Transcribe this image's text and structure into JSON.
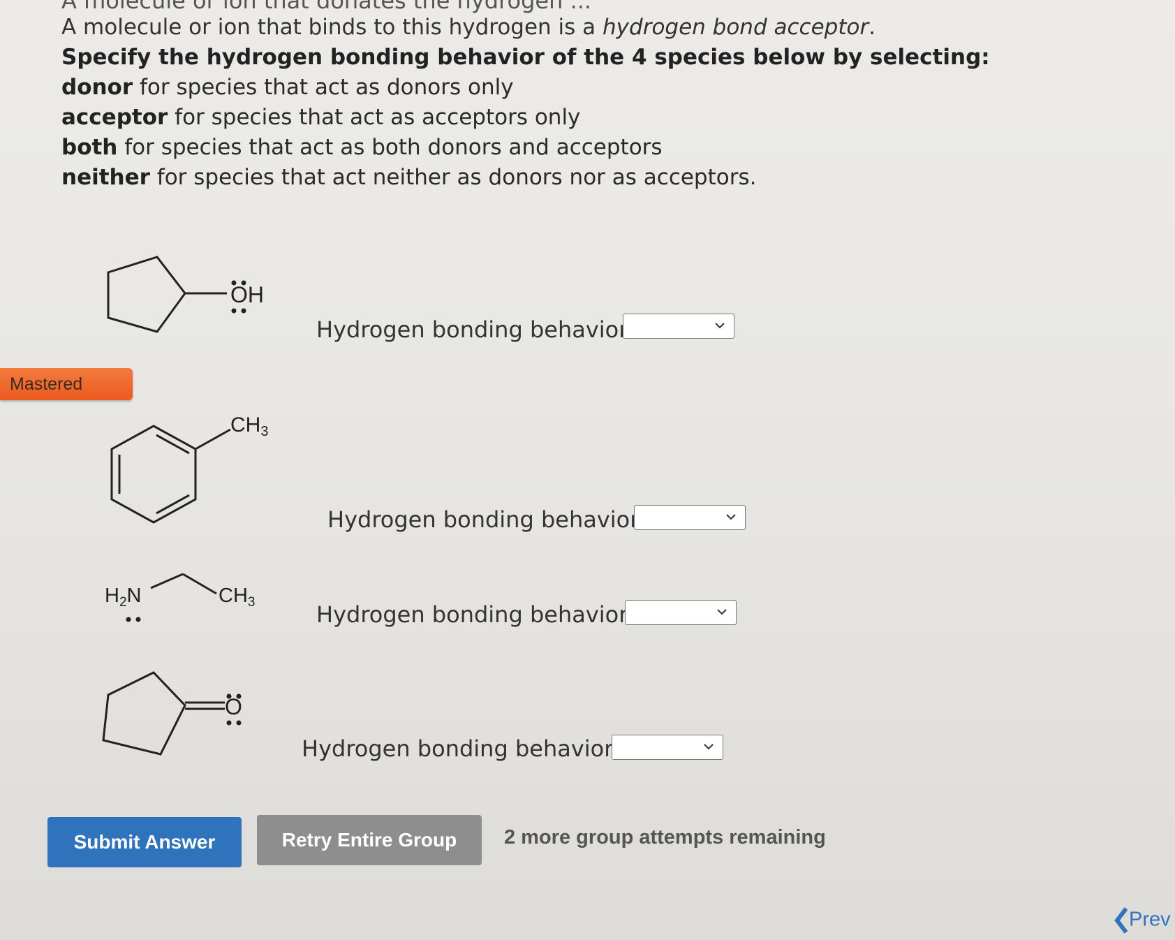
{
  "intro": {
    "cut_off_line": "A molecule or ion that donates the hydrogen ...",
    "acceptor_sentence_prefix": "A molecule or ion that binds to this hydrogen is a ",
    "acceptor_term": "hydrogen bond acceptor",
    "acceptor_sentence_suffix": "."
  },
  "instructions": {
    "heading": "Specify the hydrogen bonding behavior of the 4 species below by selecting:",
    "options": [
      {
        "term": "donor",
        "desc": " for species that act as donors only"
      },
      {
        "term": "acceptor",
        "desc": " for species that act as acceptors only"
      },
      {
        "term": "both",
        "desc": " for species that act as both donors and acceptors"
      },
      {
        "term": "neither",
        "desc": " for species that act neither as donors nor as acceptors."
      }
    ]
  },
  "badge": {
    "mastered": "Mastered"
  },
  "molecules": [
    {
      "label_1": "OH"
    },
    {
      "label_1": "CH",
      "label_1_sub": "3"
    },
    {
      "label_1": "H",
      "label_1_sub": "2",
      "label_1_tail": "N",
      "label_2": "CH",
      "label_2_sub": "3"
    },
    {
      "label_1": "O"
    }
  ],
  "questions": [
    {
      "label": "Hydrogen bonding behavior",
      "selected": ""
    },
    {
      "label": "Hydrogen bonding behavior",
      "selected": ""
    },
    {
      "label": "Hydrogen bonding behavior",
      "selected": ""
    },
    {
      "label": "Hydrogen bonding behavior",
      "selected": ""
    }
  ],
  "actions": {
    "submit": "Submit Answer",
    "retry": "Retry Entire Group",
    "attempts": "2 more group attempts remaining",
    "prev": "Prev"
  },
  "colors": {
    "submit_bg": "#2f73bd",
    "retry_bg": "#8e8e8e",
    "mastered_bg": "#ee6228"
  }
}
